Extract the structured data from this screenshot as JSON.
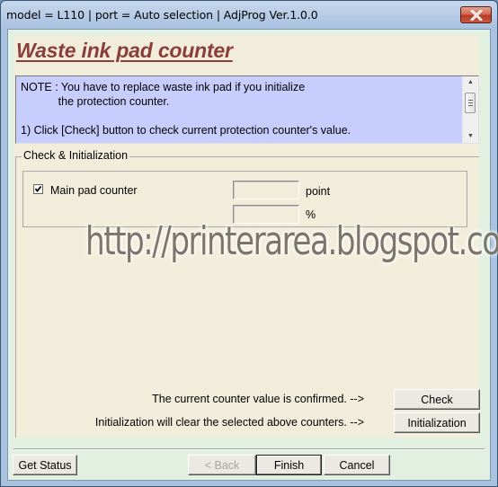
{
  "window": {
    "title": "model = L110 | port = Auto selection | AdjProg Ver.1.0.0",
    "close_icon": "close-x-icon"
  },
  "page": {
    "heading": "Waste ink pad counter"
  },
  "note": {
    "text": "NOTE : You have to replace waste ink pad if you initialize\n            the protection counter.\n\n1) Click [Check] button to check current protection counter's value."
  },
  "group": {
    "label": "Check & Initialization",
    "counter": {
      "checked": true,
      "label": "Main pad counter",
      "point_value": "",
      "point_unit": "point",
      "percent_value": "",
      "percent_unit": "%"
    }
  },
  "watermark": "http://printerarea.blogspot.com",
  "actions": {
    "check_text": "The current counter value is confirmed. -->",
    "check_button": "Check",
    "init_text": "Initialization will clear the selected above counters. -->",
    "init_button": "Initialization"
  },
  "footer": {
    "get_status": "Get Status",
    "back": "< Back",
    "finish": "Finish",
    "cancel": "Cancel"
  }
}
